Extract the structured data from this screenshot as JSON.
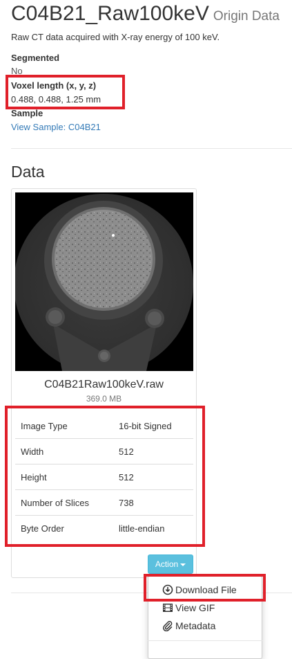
{
  "header": {
    "title": "C04B21_Raw100keV",
    "subtitle": "Origin Data",
    "description": "Raw CT data acquired with X-ray energy of 100 keV."
  },
  "properties": {
    "segmented_label": "Segmented",
    "segmented_value": "No",
    "voxel_label": "Voxel length (x, y, z)",
    "voxel_value": "0.488, 0.488, 1.25 mm",
    "sample_label": "Sample",
    "sample_link": "View Sample: C04B21"
  },
  "data_section": {
    "title": "Data",
    "file": {
      "name": "C04B21Raw100keV.raw",
      "size": "369.0 MB",
      "info": [
        {
          "key": "Image Type",
          "value": "16-bit Signed"
        },
        {
          "key": "Width",
          "value": "512"
        },
        {
          "key": "Height",
          "value": "512"
        },
        {
          "key": "Number of Slices",
          "value": "738"
        },
        {
          "key": "Byte Order",
          "value": "little-endian"
        }
      ]
    },
    "action_label": "Action",
    "menu": [
      {
        "label": "Download File",
        "icon": "download-icon"
      },
      {
        "label": "View GIF",
        "icon": "film-icon"
      },
      {
        "label": "Metadata",
        "icon": "paperclip-icon"
      }
    ]
  },
  "colors": {
    "accent_link": "#337ab7",
    "action_button": "#5bc0de",
    "highlight": "#e0202a"
  }
}
